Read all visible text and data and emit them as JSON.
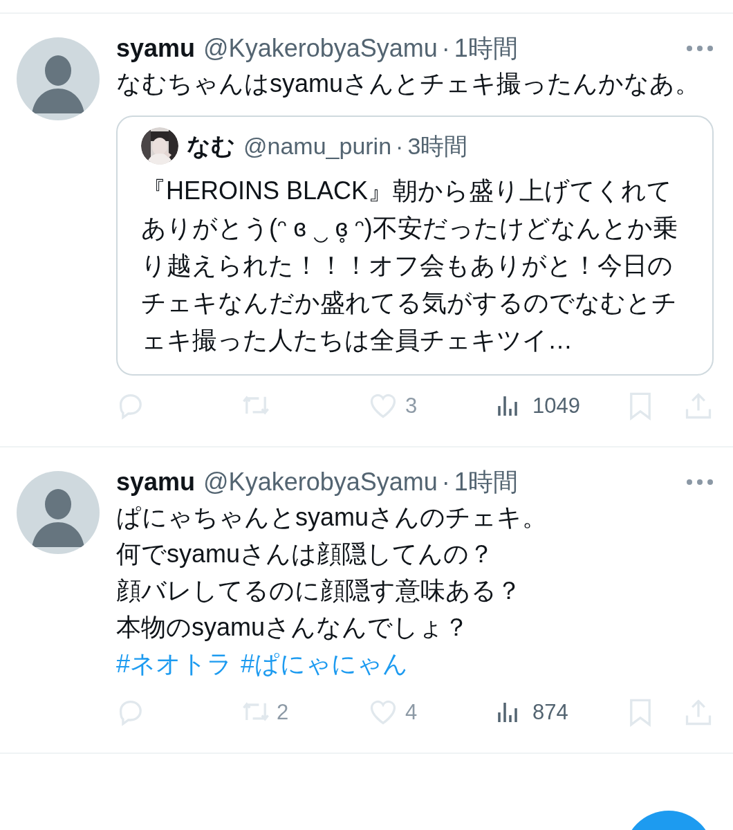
{
  "tweets": [
    {
      "name": "syamu",
      "handle": "@KyakerobyaSyamu",
      "separator": "·",
      "time": "1時間",
      "body_lines": [
        "なむちゃんはsyamuさんとチェキ撮ったんかなあ。"
      ],
      "quote": {
        "name": "なむ",
        "handle": "@namu_purin",
        "separator": "·",
        "time": "3時間",
        "body": "『HEROINS BLACK』朝から盛り上げてくれてありがとう(ᵔ ɞ ‿ ɞ̥ ᵔ)不安だったけどなんとか乗り越えられた！！！オフ会もありがと！今日のチェキなんだか盛れてる気がするのでなむとチェキ撮った人たちは全員チェキツイ…"
      },
      "counts": {
        "likes": "3",
        "views": "1049"
      }
    },
    {
      "name": "syamu",
      "handle": "@KyakerobyaSyamu",
      "separator": "·",
      "time": "1時間",
      "body_lines": [
        "ぱにゃちゃんとsyamuさんのチェキ。",
        "何でsyamuさんは顔隠してんの？",
        "顔バレしてるのに顔隠す意味ある？",
        "本物のsyamuさんなんでしょ？"
      ],
      "hashtags": [
        "#ネオトラ",
        "#ぱにゃにゃん"
      ],
      "counts": {
        "retweets": "2",
        "likes": "4",
        "views": "874"
      }
    }
  ]
}
